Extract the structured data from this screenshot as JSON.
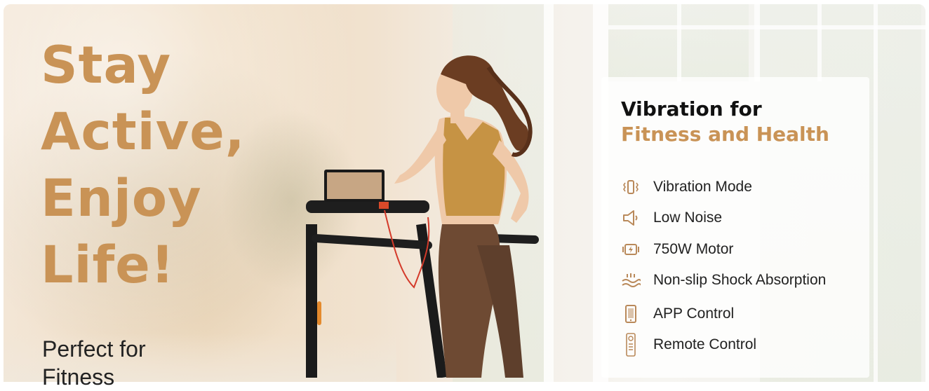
{
  "headline": {
    "line1": "Stay",
    "line2": "Active,",
    "line3": "Enjoy",
    "line4": "Life!"
  },
  "subtitle": {
    "line1": "Perfect for",
    "line2": "Fitness"
  },
  "panel": {
    "title_line1": "Vibration for",
    "title_line2": "Fitness and Health",
    "features": [
      {
        "label": "Vibration Mode",
        "icon": "vibration-icon"
      },
      {
        "label": "Low Noise",
        "icon": "speaker-icon"
      },
      {
        "label": "750W Motor",
        "icon": "motor-icon"
      },
      {
        "label": "Non-slip Shock Absorption",
        "icon": "shock-absorption-icon"
      },
      {
        "label": "APP Control",
        "icon": "phone-icon"
      },
      {
        "label": "Remote Control",
        "icon": "remote-icon"
      }
    ]
  },
  "colors": {
    "accent": "#c99356",
    "text": "#222222",
    "title": "#111111",
    "icon": "#b9895a"
  }
}
